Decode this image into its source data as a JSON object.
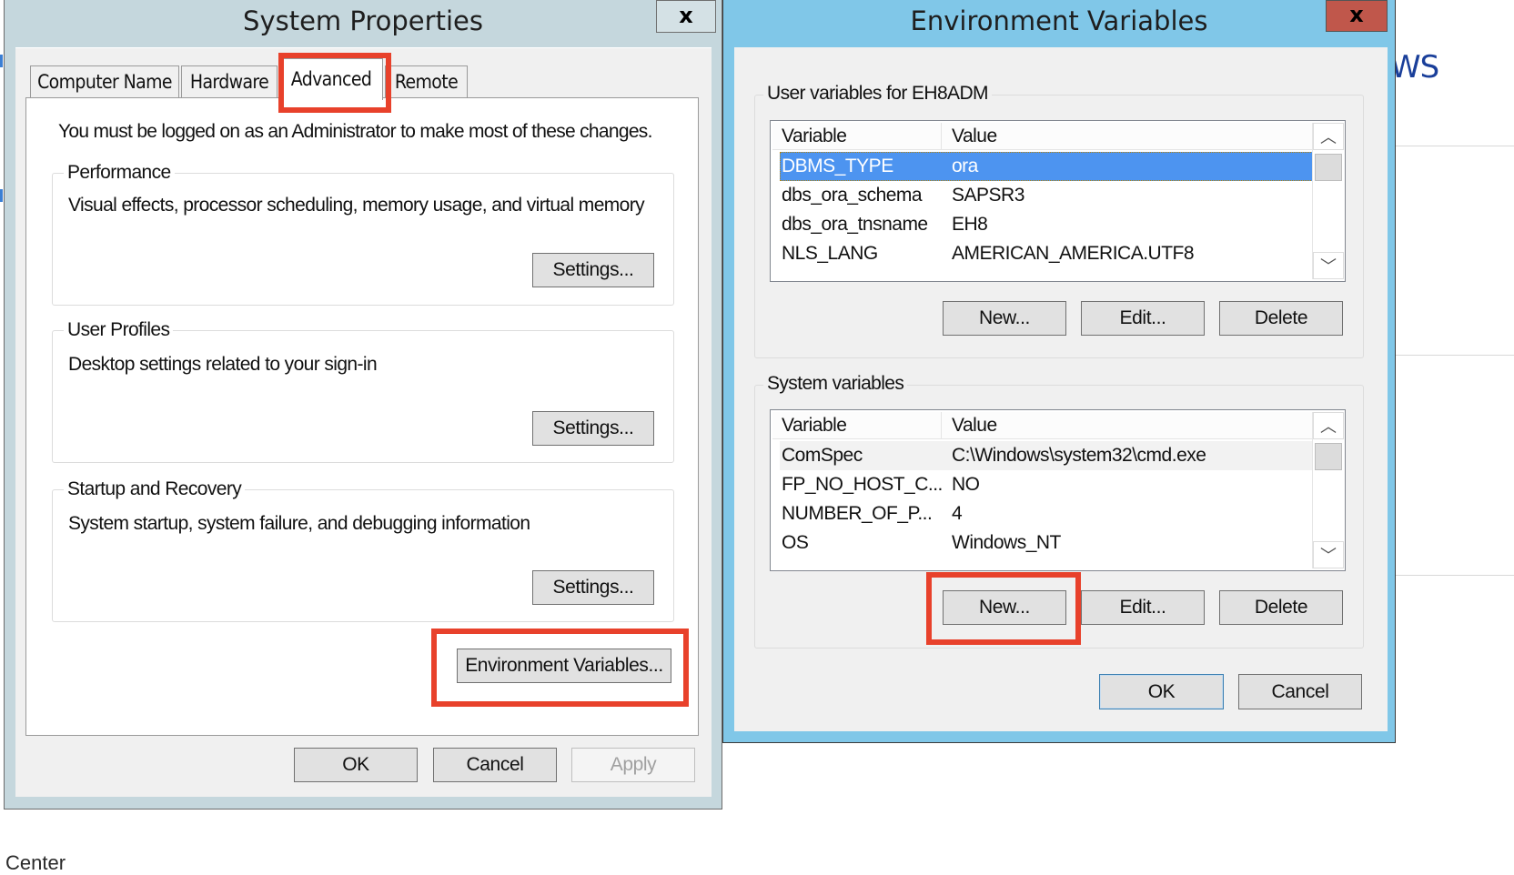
{
  "background": {
    "fragment_right": "WS",
    "fragment_bottom": "Center"
  },
  "system_properties": {
    "title": "System Properties",
    "close_label": "x",
    "tabs": [
      {
        "label": "Computer Name",
        "active": false
      },
      {
        "label": "Hardware",
        "active": false
      },
      {
        "label": "Advanced",
        "active": true
      },
      {
        "label": "Remote",
        "active": false
      }
    ],
    "admin_note": "You must be logged on as an Administrator to make most of these changes.",
    "groups": [
      {
        "label": "Performance",
        "description": "Visual effects, processor scheduling, memory usage, and virtual memory",
        "button": "Settings..."
      },
      {
        "label": "User Profiles",
        "description": "Desktop settings related to your sign-in",
        "button": "Settings..."
      },
      {
        "label": "Startup and Recovery",
        "description": "System startup, system failure, and debugging information",
        "button": "Settings..."
      }
    ],
    "env_button": "Environment Variables...",
    "ok": "OK",
    "cancel": "Cancel",
    "apply": "Apply"
  },
  "environment_variables": {
    "title": "Environment Variables",
    "close_label": "x",
    "user_section": {
      "label": "User variables for EH8ADM",
      "columns": [
        "Variable",
        "Value"
      ],
      "rows": [
        {
          "variable": "DBMS_TYPE",
          "value": "ora",
          "selected": true
        },
        {
          "variable": "dbs_ora_schema",
          "value": "SAPSR3"
        },
        {
          "variable": "dbs_ora_tnsname",
          "value": "EH8"
        },
        {
          "variable": "NLS_LANG",
          "value": "AMERICAN_AMERICA.UTF8"
        }
      ],
      "buttons": {
        "new": "New...",
        "edit": "Edit...",
        "delete": "Delete"
      }
    },
    "system_section": {
      "label": "System variables",
      "columns": [
        "Variable",
        "Value"
      ],
      "rows": [
        {
          "variable": "ComSpec",
          "value": "C:\\Windows\\system32\\cmd.exe"
        },
        {
          "variable": "FP_NO_HOST_C...",
          "value": "NO"
        },
        {
          "variable": "NUMBER_OF_P...",
          "value": "4"
        },
        {
          "variable": "OS",
          "value": "Windows_NT"
        }
      ],
      "buttons": {
        "new": "New...",
        "edit": "Edit...",
        "delete": "Delete"
      }
    },
    "ok": "OK",
    "cancel": "Cancel"
  },
  "scroll_icons": {
    "up": "︿",
    "down": "﹀"
  },
  "highlight_color": "#e8412b"
}
